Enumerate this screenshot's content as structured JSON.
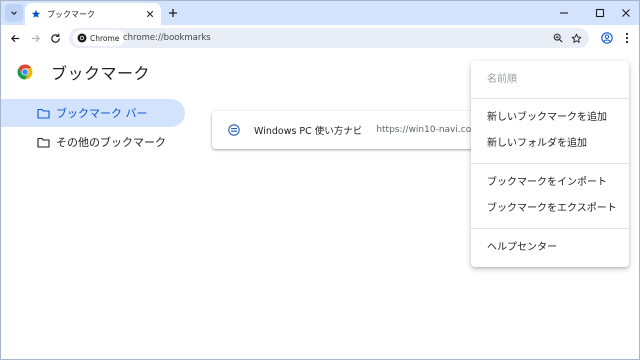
{
  "tab": {
    "title": "ブックマーク"
  },
  "toolbar": {
    "site_chip": "Chrome",
    "url": "chrome://bookmarks"
  },
  "page": {
    "title": "ブックマーク"
  },
  "sidebar": {
    "items": [
      {
        "label": "ブックマーク バー",
        "active": true
      },
      {
        "label": "その他のブックマーク",
        "active": false
      }
    ]
  },
  "bookmarks": [
    {
      "title": "Windows PC 使い方ナビ",
      "url": "https://win10-navi.com/"
    }
  ],
  "menu": {
    "sort_label": "名前順",
    "add_bookmark": "新しいブックマークを追加",
    "add_folder": "新しいフォルダを追加",
    "import": "ブックマークをインポート",
    "export": "ブックマークをエクスポート",
    "help": "ヘルプセンター"
  },
  "colors": {
    "tabstrip": "#d3e3fd",
    "accent": "#0b57d0",
    "omnibox": "#e9eef6"
  },
  "icons": [
    "tab-search-icon",
    "star-icon",
    "close-icon",
    "plus-icon",
    "minimize-icon",
    "maximize-icon",
    "back-icon",
    "forward-icon",
    "reload-icon",
    "chrome-icon",
    "zoom-icon",
    "bookmark-star-icon",
    "profile-icon",
    "kebab-icon",
    "folder-icon",
    "favicon-icon"
  ]
}
